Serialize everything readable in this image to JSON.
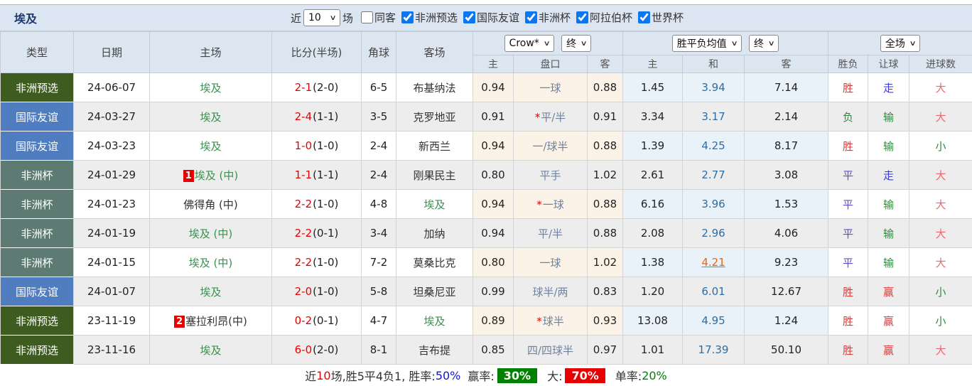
{
  "title": "埃及",
  "filters": {
    "recent_label": "近",
    "recent_value": "10",
    "games_label": "场",
    "checkboxes": [
      {
        "label": "同客",
        "checked": false
      },
      {
        "label": "非洲预选",
        "checked": true
      },
      {
        "label": "国际友谊",
        "checked": true
      },
      {
        "label": "非洲杯",
        "checked": true
      },
      {
        "label": "阿拉伯杯",
        "checked": true
      },
      {
        "label": "世界杯",
        "checked": true
      }
    ]
  },
  "header": {
    "static_cols": [
      "类型",
      "日期",
      "主场",
      "比分(半场)",
      "角球",
      "客场"
    ],
    "odds_company_select": "Crow*",
    "odds_time_select": "终",
    "odds_subcols": [
      "主",
      "盘口",
      "客"
    ],
    "avg_select": "胜平负均值",
    "avg_time_select": "终",
    "avg_subcols": [
      "主",
      "和",
      "客"
    ],
    "scope_select": "全场",
    "result_cols": [
      "胜负",
      "让球",
      "进球数"
    ]
  },
  "colors": {
    "checkbox_blue": "#0b76ef",
    "title_navy": "#1d3a6e",
    "egypt_green": "#3a9150",
    "team_dark": "#333333",
    "score_red": "#e60000",
    "badge_red": "#e60000",
    "win_red": "#dc3a3a",
    "lose_green": "#2f8a3e",
    "draw_purple": "#5b4fd0",
    "push_blue": "#3a3ad6",
    "big_lightred": "#ee6671",
    "hot_orange": "#e8650f",
    "avg_draw_blue": "#2e6da4",
    "rate_blue": "#1414d0",
    "block_green": "#008000",
    "block_red": "#e60000",
    "pct_green": "#008000",
    "type_african_qual": "#3e5c20",
    "type_friendly": "#4f7dbf",
    "type_afcon": "#5d7b72"
  },
  "rows": [
    {
      "type": "非洲预选",
      "type_color": "type_african_qual",
      "date": "24-06-07",
      "home": "埃及",
      "home_badge": "",
      "home_green": true,
      "score": "2-1",
      "half": "(2-0)",
      "corners": "6-5",
      "away": "布基纳法",
      "away_green": false,
      "o1": "0.94",
      "handicap": "一球",
      "star": false,
      "o2": "0.88",
      "avg_h": "1.45",
      "avg_d": "3.94",
      "avg_a": "7.14",
      "hot": false,
      "result": "胜",
      "result_color": "win_red",
      "hres": "走",
      "hres_color": "push_blue",
      "goals": "大",
      "goals_color": "big_lightred"
    },
    {
      "type": "国际友谊",
      "type_color": "type_friendly",
      "date": "24-03-27",
      "home": "埃及",
      "home_badge": "",
      "home_green": true,
      "score": "2-4",
      "half": "(1-1)",
      "corners": "3-5",
      "away": "克罗地亚",
      "away_green": false,
      "o1": "0.91",
      "handicap": "平/半",
      "star": true,
      "o2": "0.91",
      "avg_h": "3.34",
      "avg_d": "3.17",
      "avg_a": "2.14",
      "hot": false,
      "result": "负",
      "result_color": "lose_green",
      "hres": "输",
      "hres_color": "lose_green",
      "goals": "大",
      "goals_color": "big_lightred"
    },
    {
      "type": "国际友谊",
      "type_color": "type_friendly",
      "date": "24-03-23",
      "home": "埃及",
      "home_badge": "",
      "home_green": true,
      "score": "1-0",
      "half": "(1-0)",
      "corners": "2-4",
      "away": "新西兰",
      "away_green": false,
      "o1": "0.94",
      "handicap": "一/球半",
      "star": false,
      "o2": "0.88",
      "avg_h": "1.39",
      "avg_d": "4.25",
      "avg_a": "8.17",
      "hot": false,
      "result": "胜",
      "result_color": "win_red",
      "hres": "输",
      "hres_color": "lose_green",
      "goals": "小",
      "goals_color": "lose_green"
    },
    {
      "type": "非洲杯",
      "type_color": "type_afcon",
      "date": "24-01-29",
      "home": "埃及 (中)",
      "home_badge": "1",
      "home_green": true,
      "score": "1-1",
      "half": "(1-1)",
      "corners": "2-4",
      "away": "刚果民主",
      "away_green": false,
      "o1": "0.80",
      "handicap": "平手",
      "star": false,
      "o2": "1.02",
      "avg_h": "2.61",
      "avg_d": "2.77",
      "avg_a": "3.08",
      "hot": false,
      "result": "平",
      "result_color": "draw_purple",
      "hres": "走",
      "hres_color": "push_blue",
      "goals": "大",
      "goals_color": "big_lightred"
    },
    {
      "type": "非洲杯",
      "type_color": "type_afcon",
      "date": "24-01-23",
      "home": "佛得角 (中)",
      "home_badge": "",
      "home_green": false,
      "score": "2-2",
      "half": "(1-0)",
      "corners": "4-8",
      "away": "埃及",
      "away_green": true,
      "o1": "0.94",
      "handicap": "一球",
      "star": true,
      "o2": "0.88",
      "avg_h": "6.16",
      "avg_d": "3.96",
      "avg_a": "1.53",
      "hot": false,
      "result": "平",
      "result_color": "draw_purple",
      "hres": "输",
      "hres_color": "lose_green",
      "goals": "大",
      "goals_color": "big_lightred"
    },
    {
      "type": "非洲杯",
      "type_color": "type_afcon",
      "date": "24-01-19",
      "home": "埃及 (中)",
      "home_badge": "",
      "home_green": true,
      "score": "2-2",
      "half": "(0-1)",
      "corners": "3-4",
      "away": "加纳",
      "away_green": false,
      "o1": "0.94",
      "handicap": "平/半",
      "star": false,
      "o2": "0.88",
      "avg_h": "2.08",
      "avg_d": "2.96",
      "avg_a": "4.06",
      "hot": false,
      "result": "平",
      "result_color": "draw_purple",
      "hres": "输",
      "hres_color": "lose_green",
      "goals": "大",
      "goals_color": "big_lightred"
    },
    {
      "type": "非洲杯",
      "type_color": "type_afcon",
      "date": "24-01-15",
      "home": "埃及 (中)",
      "home_badge": "",
      "home_green": true,
      "score": "2-2",
      "half": "(1-0)",
      "corners": "7-2",
      "away": "莫桑比克",
      "away_green": false,
      "o1": "0.80",
      "handicap": "一球",
      "star": false,
      "o2": "1.02",
      "avg_h": "1.38",
      "avg_d": "4.21",
      "avg_a": "9.23",
      "hot": true,
      "result": "平",
      "result_color": "draw_purple",
      "hres": "输",
      "hres_color": "lose_green",
      "goals": "大",
      "goals_color": "big_lightred"
    },
    {
      "type": "国际友谊",
      "type_color": "type_friendly",
      "date": "24-01-07",
      "home": "埃及",
      "home_badge": "",
      "home_green": true,
      "score": "2-0",
      "half": "(1-0)",
      "corners": "5-8",
      "away": "坦桑尼亚",
      "away_green": false,
      "o1": "0.99",
      "handicap": "球半/两",
      "star": false,
      "o2": "0.83",
      "avg_h": "1.20",
      "avg_d": "6.01",
      "avg_a": "12.67",
      "hot": false,
      "result": "胜",
      "result_color": "win_red",
      "hres": "赢",
      "hres_color": "win_red",
      "goals": "小",
      "goals_color": "lose_green"
    },
    {
      "type": "非洲预选",
      "type_color": "type_african_qual",
      "date": "23-11-19",
      "home": "塞拉利昂(中)",
      "home_badge": "2",
      "home_green": false,
      "score": "0-2",
      "half": "(0-1)",
      "corners": "4-7",
      "away": "埃及",
      "away_green": true,
      "o1": "0.89",
      "handicap": "球半",
      "star": true,
      "o2": "0.93",
      "avg_h": "13.08",
      "avg_d": "4.95",
      "avg_a": "1.24",
      "hot": false,
      "result": "胜",
      "result_color": "win_red",
      "hres": "赢",
      "hres_color": "win_red",
      "goals": "小",
      "goals_color": "lose_green"
    },
    {
      "type": "非洲预选",
      "type_color": "type_african_qual",
      "date": "23-11-16",
      "home": "埃及",
      "home_badge": "",
      "home_green": true,
      "score": "6-0",
      "half": "(2-0)",
      "corners": "8-1",
      "away": "吉布提",
      "away_green": false,
      "o1": "0.85",
      "handicap": "四/四球半",
      "star": false,
      "o2": "0.97",
      "avg_h": "1.01",
      "avg_d": "17.39",
      "avg_a": "50.10",
      "hot": false,
      "result": "胜",
      "result_color": "win_red",
      "hres": "赢",
      "hres_color": "win_red",
      "goals": "大",
      "goals_color": "big_lightred"
    }
  ],
  "footer": {
    "prefix": "近",
    "count": "10",
    "stats": "场,胜5平4负1, 胜率:",
    "win_rate": "50%",
    "label_win": "赢率:",
    "win_pct": "30%",
    "label_big": "大:",
    "big_pct": "70%",
    "label_single": "单率:",
    "single_pct": "20%"
  }
}
